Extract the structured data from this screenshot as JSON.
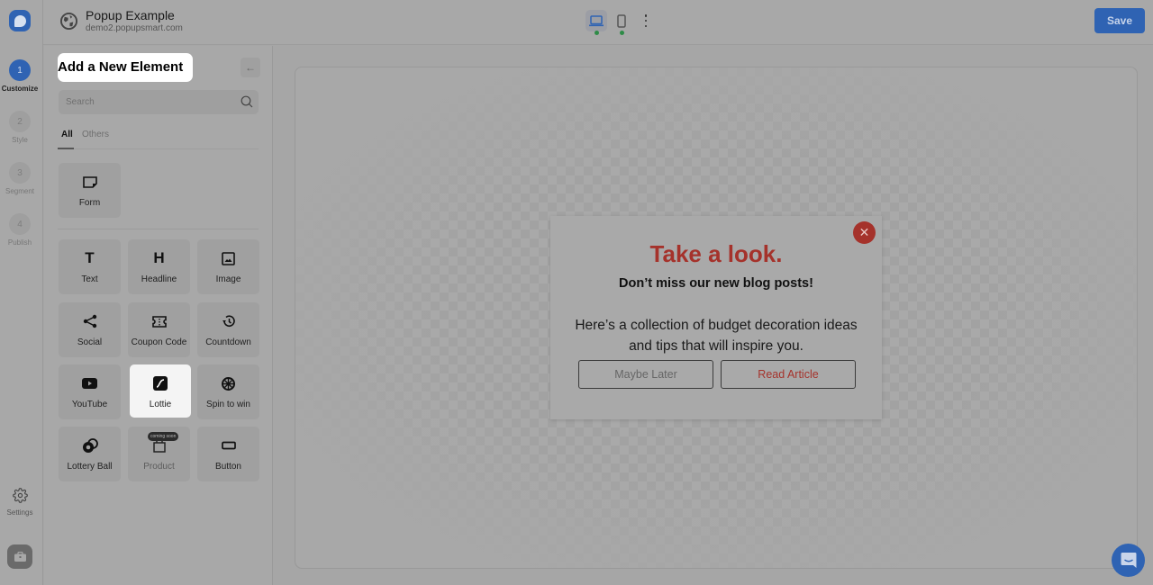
{
  "rail": {
    "steps": [
      {
        "num": "1",
        "label": "Customize",
        "active": true
      },
      {
        "num": "2",
        "label": "Style"
      },
      {
        "num": "3",
        "label": "Segment"
      },
      {
        "num": "4",
        "label": "Publish"
      }
    ],
    "settings_label": "Settings"
  },
  "header": {
    "title": "Popup Example",
    "url": "demo2.popupsmart.com",
    "save_label": "Save",
    "devices": [
      "desktop",
      "mobile"
    ],
    "active_device": "desktop"
  },
  "panel": {
    "title": "Add a New Element",
    "search_placeholder": "Search",
    "tabs": [
      {
        "label": "All",
        "active": true
      },
      {
        "label": "Others"
      }
    ],
    "form_tiles": [
      {
        "label": "Form",
        "icon": "form-icon"
      }
    ],
    "element_tiles": [
      {
        "label": "Text",
        "icon": "text-icon"
      },
      {
        "label": "Headline",
        "icon": "headline-icon"
      },
      {
        "label": "Image",
        "icon": "image-icon"
      },
      {
        "label": "Social",
        "icon": "share-icon"
      },
      {
        "label": "Coupon Code",
        "icon": "ticket-icon"
      },
      {
        "label": "Countdown",
        "icon": "history-icon"
      },
      {
        "label": "YouTube",
        "icon": "youtube-icon"
      },
      {
        "label": "Lottie",
        "icon": "lottie-icon",
        "selected": true
      },
      {
        "label": "Spin to win",
        "icon": "wheel-icon"
      },
      {
        "label": "Lottery Ball",
        "icon": "lottery-ball-icon"
      },
      {
        "label": "Product",
        "icon": "product-icon",
        "badge": "coming soon",
        "disabled": true
      },
      {
        "label": "Button",
        "icon": "button-icon"
      }
    ]
  },
  "popup": {
    "title": "Take a look.",
    "subtitle": "Don’t miss our new blog posts!",
    "body": "Here’s a collection of budget decoration ideas and tips that will inspire you.",
    "secondary_button": "Maybe Later",
    "primary_button": "Read Article",
    "accent_color": "#a5322b"
  },
  "colors": {
    "brand": "#2f63b3",
    "status_dot": "#2e8b47"
  }
}
